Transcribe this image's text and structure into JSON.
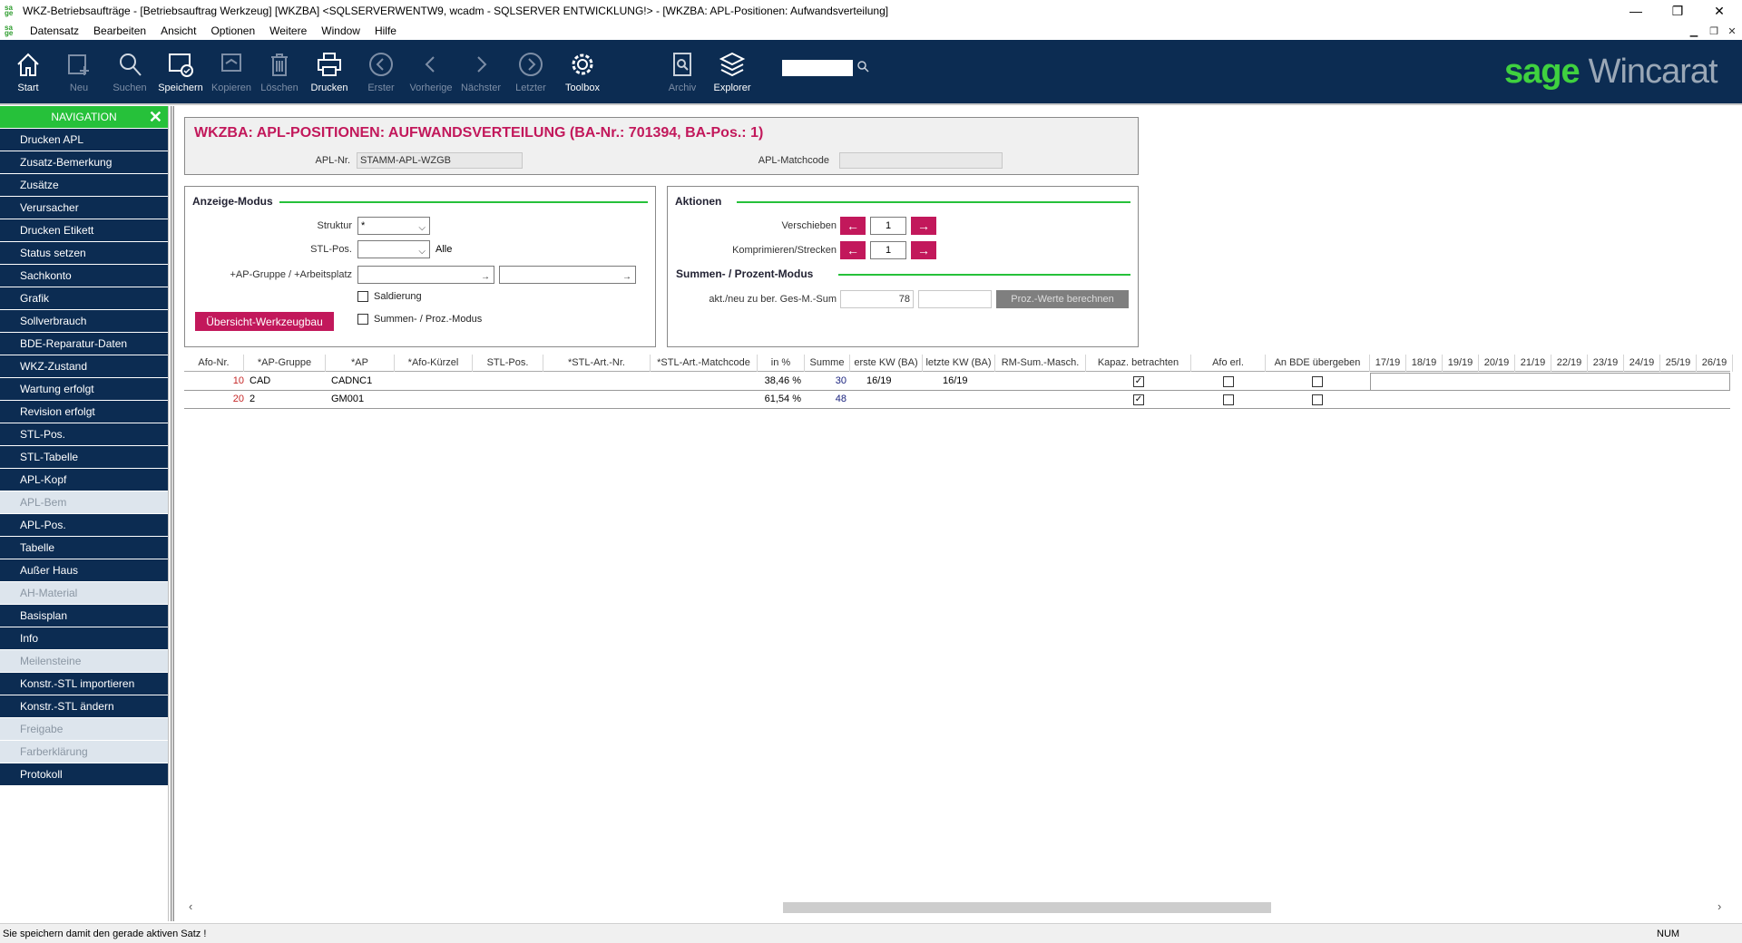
{
  "window": {
    "title": "WKZ-Betriebsaufträge - [Betriebsauftrag Werkzeug] [WKZBA] <SQLSERVERWENTW9, wcadm - SQLSERVER ENTWICKLUNG!> - [WKZBA: APL-Positionen: Aufwandsverteilung]",
    "minimize": "—",
    "restore": "❐",
    "close": "✕"
  },
  "menu": [
    "Datensatz",
    "Bearbeiten",
    "Ansicht",
    "Optionen",
    "Weitere",
    "Window",
    "Hilfe"
  ],
  "toolbar": {
    "start": "Start",
    "neu": "Neu",
    "suchen": "Suchen",
    "speichern": "Speichern",
    "kopieren": "Kopieren",
    "loeschen": "Löschen",
    "drucken": "Drucken",
    "erster": "Erster",
    "vorherige": "Vorherige",
    "naechster": "Nächster",
    "letzter": "Letzter",
    "toolbox": "Toolbox",
    "archiv": "Archiv",
    "explorer": "Explorer",
    "search_value": "",
    "brand_sage": "sage",
    "brand_product": "Wincarat"
  },
  "nav": {
    "header": "NAVIGATION",
    "items": [
      {
        "label": "Drucken APL",
        "state": "active"
      },
      {
        "label": "Zusatz-Bemerkung",
        "state": "active"
      },
      {
        "label": "Zusätze",
        "state": "active"
      },
      {
        "label": "Verursacher",
        "state": "active"
      },
      {
        "label": "Drucken Etikett",
        "state": "active"
      },
      {
        "label": "Status setzen",
        "state": "active"
      },
      {
        "label": "Sachkonto",
        "state": "active"
      },
      {
        "label": "Grafik",
        "state": "active"
      },
      {
        "label": "Sollverbrauch",
        "state": "active"
      },
      {
        "label": "BDE-Reparatur-Daten",
        "state": "active"
      },
      {
        "label": "WKZ-Zustand",
        "state": "active"
      },
      {
        "label": "Wartung erfolgt",
        "state": "active"
      },
      {
        "label": "Revision erfolgt",
        "state": "active"
      },
      {
        "label": "STL-Pos.",
        "state": "active"
      },
      {
        "label": "STL-Tabelle",
        "state": "active"
      },
      {
        "label": "APL-Kopf",
        "state": "active"
      },
      {
        "label": "APL-Bem",
        "state": "disabled"
      },
      {
        "label": "APL-Pos.",
        "state": "active"
      },
      {
        "label": "Tabelle",
        "state": "active"
      },
      {
        "label": "Außer Haus",
        "state": "active"
      },
      {
        "label": "AH-Material",
        "state": "disabled"
      },
      {
        "label": "Basisplan",
        "state": "active"
      },
      {
        "label": "Info",
        "state": "active"
      },
      {
        "label": "Meilensteine",
        "state": "disabled"
      },
      {
        "label": "Konstr.-STL importieren",
        "state": "active"
      },
      {
        "label": "Konstr.-STL ändern",
        "state": "active"
      },
      {
        "label": "Freigabe",
        "state": "disabled"
      },
      {
        "label": "Farberklärung",
        "state": "disabled"
      },
      {
        "label": "Protokoll",
        "state": "active"
      }
    ]
  },
  "header": {
    "title": "WKZBA: APL-POSITIONEN: AUFWANDSVERTEILUNG (BA-Nr.: 701394, BA-Pos.: 1)",
    "apl_nr_label": "APL-Nr.",
    "apl_nr_value": "STAMM-APL-WZGB",
    "apl_matchcode_label": "APL-Matchcode",
    "apl_matchcode_value": ""
  },
  "anzeige": {
    "title": "Anzeige-Modus",
    "struktur_label": "Struktur",
    "struktur_value": "*",
    "stlpos_label": "STL-Pos.",
    "stlpos_value": "",
    "stlpos_text": "Alle",
    "apgruppe_label": "+AP-Gruppe / +Arbeitsplatz",
    "apgruppe_value": "",
    "arbeitsplatz_value": "",
    "saldierung_label": "Saldierung",
    "summen_label": "Summen- / Proz.-Modus",
    "uebersicht_button": "Übersicht-Werkzeugbau"
  },
  "aktionen": {
    "title": "Aktionen",
    "verschieben_label": "Verschieben",
    "verschieben_value": "1",
    "komprimieren_label": "Komprimieren/Strecken",
    "komprimieren_value": "1",
    "summen_title": "Summen- / Prozent-Modus",
    "akt_label": "akt./neu zu ber. Ges-M.-Sum",
    "akt_value": "78",
    "neu_value": "",
    "proz_button": "Proz.-Werte berechnen"
  },
  "grid": {
    "headers": [
      "Afo-Nr.",
      "*AP-Gruppe",
      "*AP",
      "*Afo-Kürzel",
      "STL-Pos.",
      "*STL-Art.-Nr.",
      "*STL-Art.-Matchcode",
      "in %",
      "Summe",
      "erste KW (BA)",
      "letzte KW (BA)",
      "RM-Sum.-Masch.",
      "Kapaz. betrachten",
      "Afo erl.",
      "An BDE übergeben"
    ],
    "weeks": [
      "17/19",
      "18/19",
      "19/19",
      "20/19",
      "21/19",
      "22/19",
      "23/19",
      "24/19",
      "25/19",
      "26/19"
    ],
    "rows": [
      {
        "afo": "10",
        "apgruppe": "CAD",
        "ap": "CADNC1",
        "kuerzel": "",
        "stlpos": "",
        "artnr": "",
        "matchcode": "",
        "proz": "38,46 %",
        "summe": "30",
        "erste": "16/19",
        "letzte": "16/19",
        "rm": "",
        "kapaz": true,
        "erl": false,
        "bde": false
      },
      {
        "afo": "20",
        "apgruppe": "2",
        "ap": "GM001",
        "kuerzel": "",
        "stlpos": "",
        "artnr": "",
        "matchcode": "",
        "proz": "61,54 %",
        "summe": "48",
        "erste": "",
        "letzte": "",
        "rm": "",
        "kapaz": true,
        "erl": false,
        "bde": false
      }
    ]
  },
  "status": {
    "message": "Sie speichern damit den gerade aktiven Satz !",
    "num": "NUM"
  },
  "colors": {
    "toolbar_bg": "#0c2c52",
    "nav_header": "#26c13a",
    "accent_pink": "#c2185b",
    "brand_green": "#3fd13f"
  }
}
